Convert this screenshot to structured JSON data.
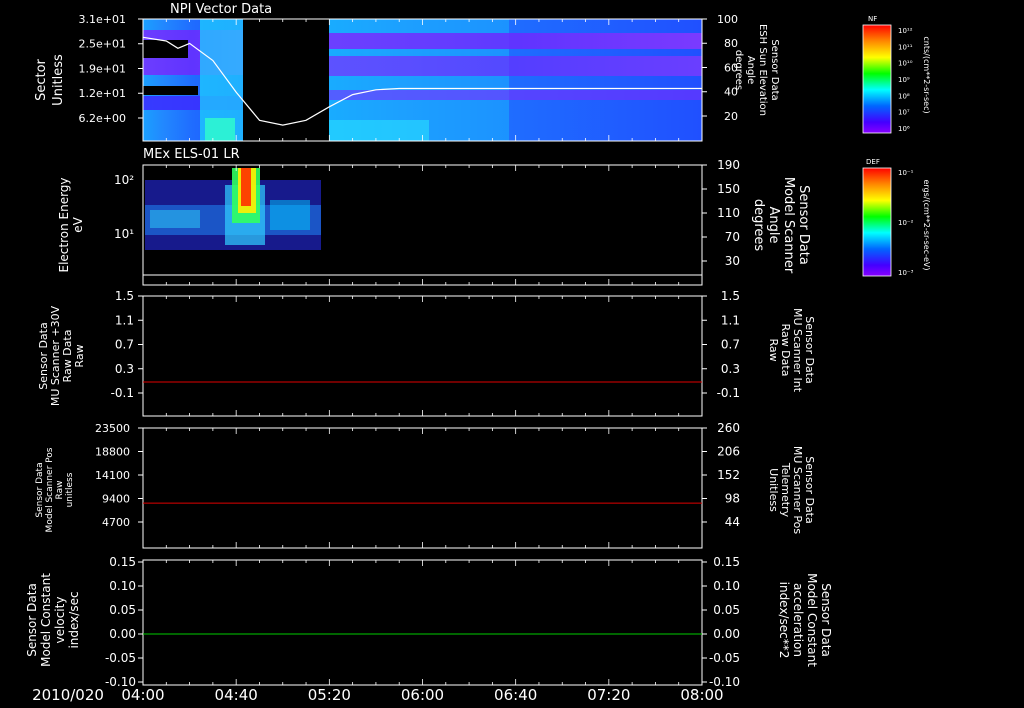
{
  "chart_data": [
    {
      "type": "heatmap",
      "title": "NPI Vector Data",
      "ylabel_left": [
        "Sector",
        "Unitless"
      ],
      "yticks_left": [
        "3.1e+01",
        "2.5e+01",
        "1.9e+01",
        "1.2e+01",
        "6.2e+00"
      ],
      "ylabel_right": [
        "Sensor Data",
        "ESH Sun Elevation",
        "Angle",
        "degrees"
      ],
      "yticks_right": [
        "100",
        "80",
        "60",
        "40",
        "20"
      ],
      "yrange_right": [
        0,
        100
      ],
      "overlay_line": {
        "name": "ESH Sun Elevation Angle",
        "x": [
          "04:00",
          "04:10",
          "04:15",
          "04:20",
          "04:30",
          "04:40",
          "04:50",
          "05:00",
          "05:10",
          "05:20",
          "05:30",
          "05:40",
          "05:50",
          "08:00"
        ],
        "y": [
          85,
          82,
          76,
          80,
          66,
          40,
          17,
          13,
          17,
          28,
          38,
          42,
          43,
          43
        ]
      },
      "data_gap": [
        "04:44",
        "05:18"
      ],
      "colorbar": {
        "label": "NF",
        "units": "cnts/(cm**2-sr-sec)",
        "ticks": [
          "10¹²",
          "10¹¹",
          "10¹⁰",
          "10⁹",
          "10⁸",
          "10⁷",
          "10⁶"
        ]
      }
    },
    {
      "type": "heatmap",
      "title": "MEx ELS-01 LR",
      "ylabel_left": [
        "Electron Energy",
        "eV"
      ],
      "yticks_left": [
        "10²",
        "10¹"
      ],
      "ylabel_right": [
        "Sensor Data",
        "Model Scanner",
        "Angle",
        "degrees"
      ],
      "yticks_right": [
        "190",
        "150",
        "110",
        "70",
        "30"
      ],
      "overlay_line": {
        "name": "Model Scanner Angle",
        "x": [
          "04:00",
          "08:00"
        ],
        "y": [
          10,
          10
        ]
      },
      "data_extent": [
        "04:00",
        "05:15"
      ],
      "colorbar": {
        "label": "DEF",
        "units": "ergs/(cm**2-sr-sec-eV)",
        "ticks": [
          "10⁻¹",
          "10⁻²",
          "10⁻³"
        ]
      }
    },
    {
      "type": "line",
      "ylabel_left": [
        "Sensor Data",
        "MU Scanner +30V",
        "Raw Data",
        "Raw"
      ],
      "yticks_left": [
        "1.5",
        "1.1",
        "0.7",
        "0.3",
        "-0.1"
      ],
      "ylabel_right": [
        "Sensor Data",
        "MU Scanner Int",
        "Raw Data",
        "Raw"
      ],
      "yticks_right": [
        "1.5",
        "1.1",
        "0.7",
        "0.3",
        "-0.1"
      ],
      "ylim": [
        -0.3,
        1.5
      ],
      "series": [
        {
          "name": "MU Scanner Int Raw Data",
          "color": "#ff0000",
          "x": [
            "04:00",
            "08:00"
          ],
          "y": [
            0.0,
            0.0
          ]
        }
      ]
    },
    {
      "type": "line",
      "ylabel_left": [
        "Sensor Data",
        "Model Scanner Pos",
        "Raw",
        "unitless"
      ],
      "yticks_left": [
        "23500",
        "18800",
        "14100",
        "9400",
        "4700"
      ],
      "ylabel_right": [
        "Sensor Data",
        "MU Scanner Pos",
        "Telemetry",
        "Unitless"
      ],
      "yticks_right": [
        "260",
        "206",
        "152",
        "98",
        "44"
      ],
      "ylim_right": [
        0,
        260
      ],
      "series": [
        {
          "name": "MU Scanner Pos Telemetry",
          "color": "#ff0000",
          "x": [
            "04:00",
            "08:00"
          ],
          "y": [
            80,
            80
          ]
        }
      ]
    },
    {
      "type": "line",
      "ylabel_left": [
        "Sensor Data",
        "Model Constant",
        "velocity",
        "index/sec"
      ],
      "yticks_left": [
        "0.15",
        "0.10",
        "0.05",
        "0.00",
        "-0.05",
        "-0.10"
      ],
      "ylabel_right": [
        "Sensor Data",
        "Model Constant",
        "acceleration",
        "index/sec**2"
      ],
      "yticks_right": [
        "0.15",
        "0.10",
        "0.05",
        "0.00",
        "-0.05",
        "-0.10"
      ],
      "ylim": [
        -0.1,
        0.15
      ],
      "series": [
        {
          "name": "Model Constant acceleration",
          "color": "#00dd00",
          "x": [
            "04:00",
            "08:00"
          ],
          "y": [
            0.0,
            0.0
          ]
        }
      ]
    }
  ],
  "time_axis": {
    "date": "2010/020",
    "ticks": [
      "04:00",
      "04:40",
      "05:20",
      "06:00",
      "06:40",
      "07:20",
      "08:00"
    ]
  },
  "colors": {
    "red_axis": "#ff2020",
    "green_axis": "#00ff00",
    "trace_red": "#e00000",
    "trace_green": "#00cc00"
  }
}
